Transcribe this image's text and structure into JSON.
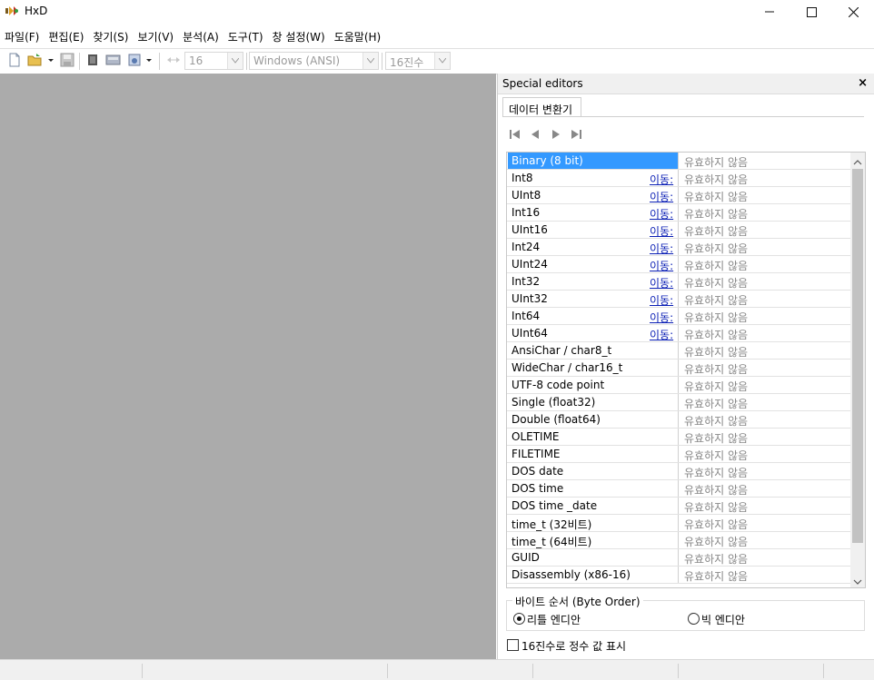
{
  "window": {
    "title": "HxD"
  },
  "menu": [
    "파일(F)",
    "편집(E)",
    "찾기(S)",
    "보기(V)",
    "분석(A)",
    "도구(T)",
    "창 설정(W)",
    "도움말(H)"
  ],
  "toolbar": {
    "bytes_per_row": "16",
    "charset": "Windows (ANSI)",
    "offset_base": "16진수"
  },
  "panel": {
    "title": "Special editors",
    "close": "×",
    "tab": "데이터 변환기",
    "rows": [
      {
        "name": "Binary (8 bit)",
        "link": "",
        "value": "유효하지 않음"
      },
      {
        "name": "Int8",
        "link": "이동:",
        "value": "유효하지 않음"
      },
      {
        "name": "UInt8",
        "link": "이동:",
        "value": "유효하지 않음"
      },
      {
        "name": "Int16",
        "link": "이동:",
        "value": "유효하지 않음"
      },
      {
        "name": "UInt16",
        "link": "이동:",
        "value": "유효하지 않음"
      },
      {
        "name": "Int24",
        "link": "이동:",
        "value": "유효하지 않음"
      },
      {
        "name": "UInt24",
        "link": "이동:",
        "value": "유효하지 않음"
      },
      {
        "name": "Int32",
        "link": "이동:",
        "value": "유효하지 않음"
      },
      {
        "name": "UInt32",
        "link": "이동:",
        "value": "유효하지 않음"
      },
      {
        "name": "Int64",
        "link": "이동:",
        "value": "유효하지 않음"
      },
      {
        "name": "UInt64",
        "link": "이동:",
        "value": "유효하지 않음"
      },
      {
        "name": "AnsiChar / char8_t",
        "link": "",
        "value": "유효하지 않음"
      },
      {
        "name": "WideChar / char16_t",
        "link": "",
        "value": "유효하지 않음"
      },
      {
        "name": "UTF-8 code point",
        "link": "",
        "value": "유효하지 않음"
      },
      {
        "name": "Single (float32)",
        "link": "",
        "value": "유효하지 않음"
      },
      {
        "name": "Double (float64)",
        "link": "",
        "value": "유효하지 않음"
      },
      {
        "name": "OLETIME",
        "link": "",
        "value": "유효하지 않음"
      },
      {
        "name": "FILETIME",
        "link": "",
        "value": "유효하지 않음"
      },
      {
        "name": "DOS date",
        "link": "",
        "value": "유효하지 않음"
      },
      {
        "name": "DOS time",
        "link": "",
        "value": "유효하지 않음"
      },
      {
        "name": "DOS time _date",
        "link": "",
        "value": "유효하지 않음"
      },
      {
        "name": "time_t (32비트)",
        "link": "",
        "value": "유효하지 않음"
      },
      {
        "name": "time_t (64비트)",
        "link": "",
        "value": "유효하지 않음"
      },
      {
        "name": "GUID",
        "link": "",
        "value": "유효하지 않음"
      },
      {
        "name": "Disassembly (x86-16)",
        "link": "",
        "value": "유효하지 않음"
      }
    ],
    "byte_order": {
      "legend": "바이트 순서 (Byte Order)",
      "little": "리틀 엔디안",
      "big": "빅 엔디안",
      "selected": "little"
    },
    "hex_checkbox": "16진수로 정수 값 표시"
  },
  "colors": {
    "workspace": "#ababab",
    "selection": "#3399ff",
    "link": "#0b1fb5"
  }
}
